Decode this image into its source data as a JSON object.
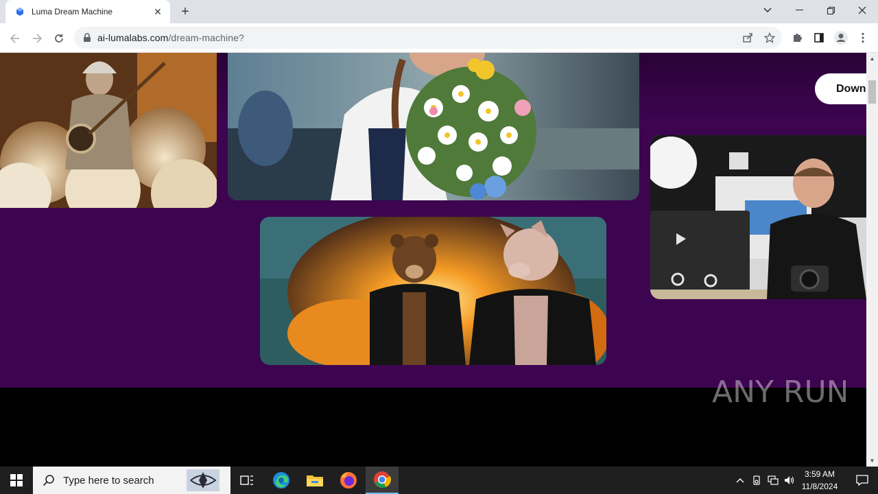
{
  "browser": {
    "tab_title": "Luma Dream Machine",
    "new_tab_label": "+",
    "url_domain": "ai-lumalabs.com",
    "url_path": "/dream-machine?"
  },
  "page": {
    "download_button_label": "Down",
    "watermark_text": "ANY RUN"
  },
  "taskbar": {
    "search_placeholder": "Type here to search",
    "time": "3:59 AM",
    "date": "11/8/2024"
  },
  "colors": {
    "page_background": "#3d0550",
    "footer": "#000000",
    "accent": "#76b9ed"
  }
}
